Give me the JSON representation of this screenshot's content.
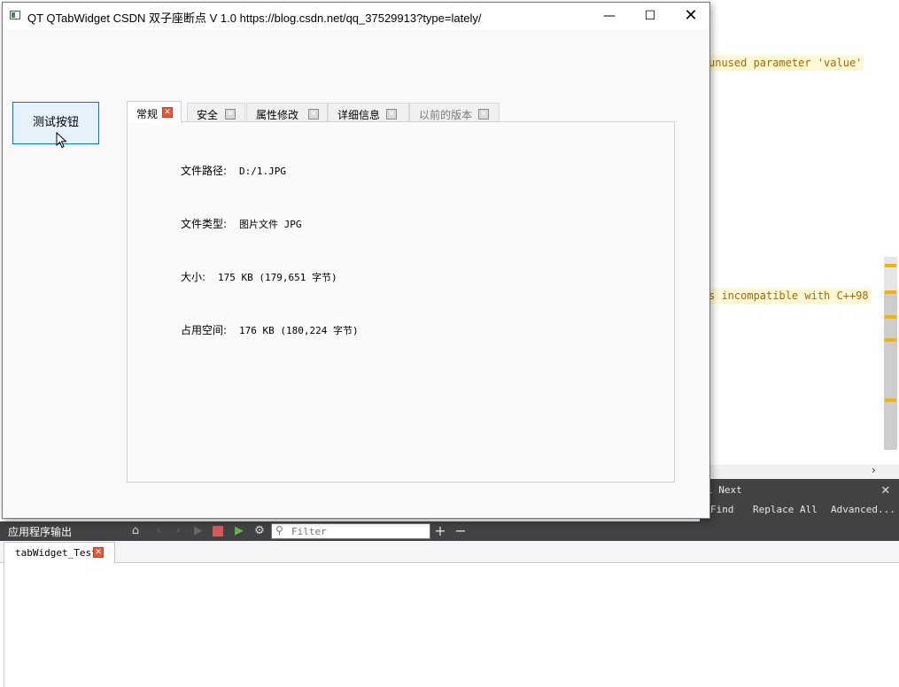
{
  "ide": {
    "warning_1": "unused parameter 'value'",
    "warning_2": "s incompatible with C++98",
    "find": {
      "next_label": "l Next",
      "find_label": "Find",
      "replace_all_label": "Replace All",
      "advanced_label": "Advanced..."
    },
    "output": {
      "title": "应用程序输出",
      "filter_placeholder": "Filter",
      "tab_label": "tabWidget_Test"
    }
  },
  "window": {
    "title": "QT QTabWidget  CSDN 双子座断点 V 1.0 https://blog.csdn.net/qq_37529913?type=lately/",
    "test_button_label": "测试按钮",
    "tabs": [
      {
        "label": "常规",
        "active": true,
        "enabled": true
      },
      {
        "label": "安全",
        "active": false,
        "enabled": true
      },
      {
        "label": "属性修改",
        "active": false,
        "enabled": true
      },
      {
        "label": "详细信息",
        "active": false,
        "enabled": true
      },
      {
        "label": "以前的版本",
        "active": false,
        "enabled": false
      }
    ],
    "info": [
      {
        "label": "文件路径:",
        "value": "D:/1.JPG"
      },
      {
        "label": "文件类型:",
        "value": "图片文件 JPG"
      },
      {
        "label": "大小:",
        "value": "175 KB (179,651 字节)"
      },
      {
        "label": "占用空间:",
        "value": "176 KB (180,224 字节)"
      }
    ]
  },
  "colors": {
    "active_tab_close": "#e05a3a",
    "button_border": "#0078d7",
    "output_bar": "#404244"
  }
}
